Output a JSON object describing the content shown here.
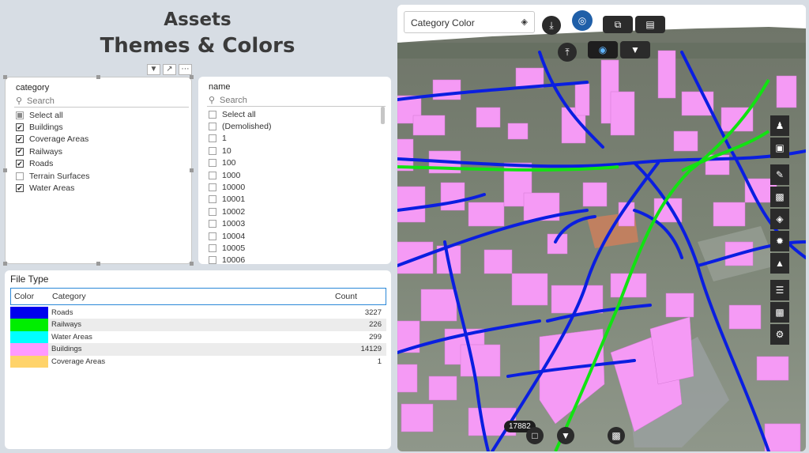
{
  "header": {
    "title": "Assets",
    "subtitle": "Themes & Colors"
  },
  "visual_header": {
    "icons": [
      "filter-icon",
      "focus-mode-icon",
      "more-options-icon"
    ]
  },
  "category_slicer": {
    "title": "category",
    "search_placeholder": "Search",
    "items": [
      {
        "label": "Select all",
        "state": "partial"
      },
      {
        "label": "Buildings",
        "state": "checked"
      },
      {
        "label": "Coverage Areas",
        "state": "checked"
      },
      {
        "label": "Railways",
        "state": "checked"
      },
      {
        "label": "Roads",
        "state": "checked"
      },
      {
        "label": "Terrain Surfaces",
        "state": "unchecked"
      },
      {
        "label": "Water Areas",
        "state": "checked"
      }
    ]
  },
  "name_slicer": {
    "title": "name",
    "search_placeholder": "Search",
    "items": [
      "Select all",
      "(Demolished)",
      "1",
      "10",
      "100",
      "1000",
      "10000",
      "10001",
      "10002",
      "10003",
      "10004",
      "10005",
      "10006"
    ]
  },
  "file_type": {
    "title": "File Type",
    "columns": {
      "color": "Color",
      "category": "Category",
      "count": "Count"
    },
    "rows": [
      {
        "color": "#0000ee",
        "category": "Roads",
        "count": "3227"
      },
      {
        "color": "#00ee00",
        "category": "Railways",
        "count": "226"
      },
      {
        "color": "#00ffff",
        "category": "Water Areas",
        "count": "299"
      },
      {
        "color": "#ff99ff",
        "category": "Buildings",
        "count": "14129"
      },
      {
        "color": "#ffd36a",
        "category": "Coverage Areas",
        "count": "1"
      }
    ]
  },
  "map": {
    "theme_selector": "Category Color",
    "feature_count": "17882",
    "colors": {
      "roads": "#0a1ee0",
      "railways": "#12e212",
      "buildings": "#f59af5",
      "terrain": "#7f8a78",
      "sky": "#ffffff"
    }
  }
}
